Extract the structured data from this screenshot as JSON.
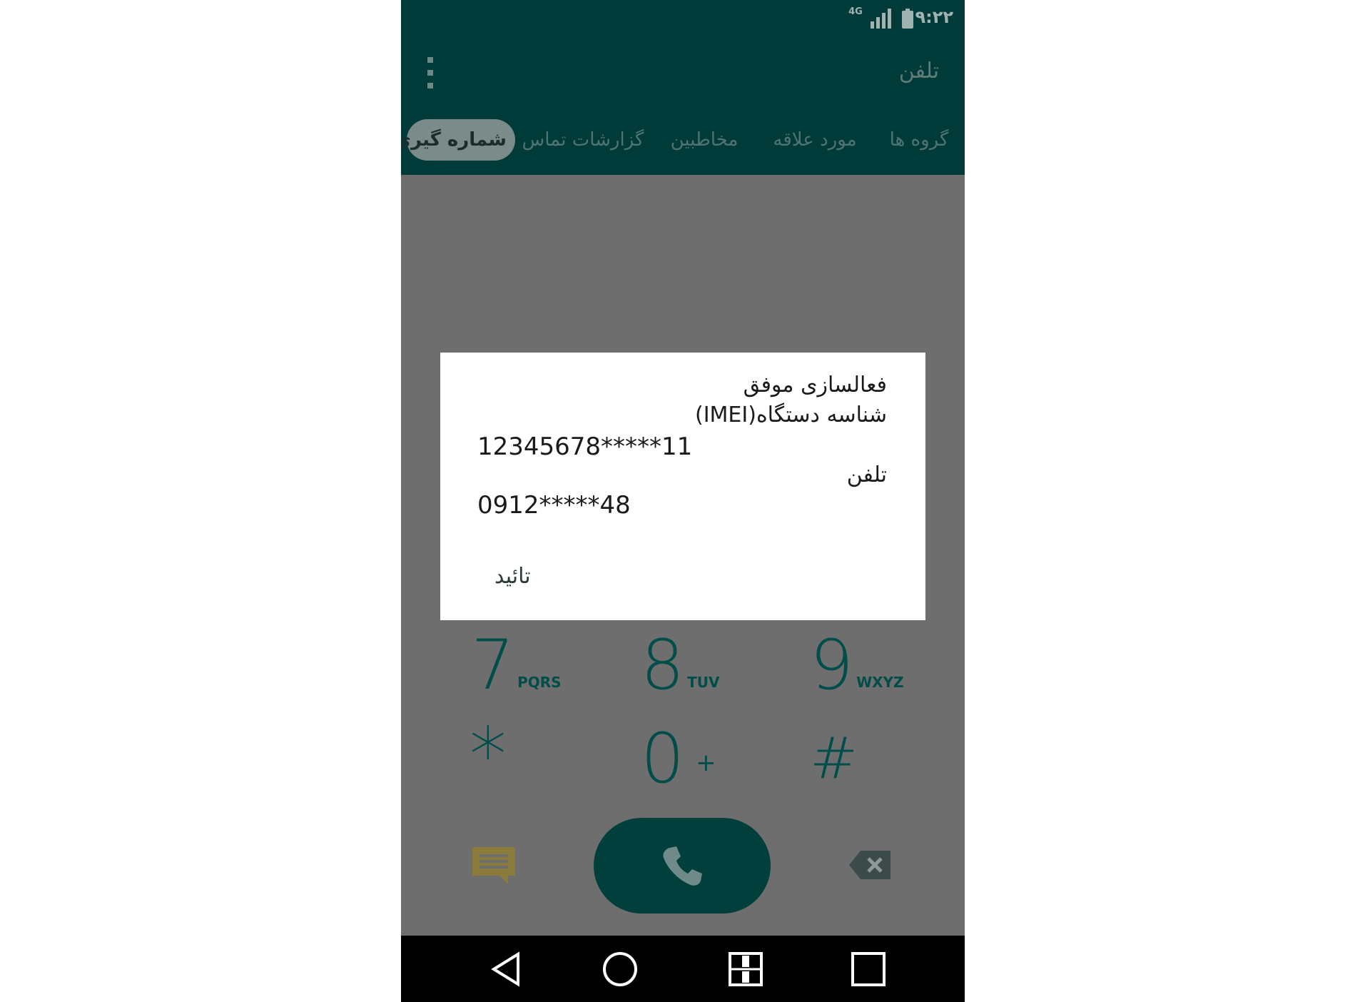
{
  "status_bar": {
    "time": "۹:۲۲",
    "network_label": "4G",
    "icons": [
      "lte-icon",
      "signal-icon",
      "battery-icon"
    ]
  },
  "app_bar": {
    "title": "تلفن",
    "menu_icon": "overflow-menu-icon"
  },
  "tabs": [
    {
      "label": "گروه ها",
      "active": false
    },
    {
      "label": "مورد علاقه",
      "active": false
    },
    {
      "label": "مخاطبین",
      "active": false
    },
    {
      "label": "گزارشات تماس",
      "active": false
    },
    {
      "label": "شماره گیری",
      "active": true
    }
  ],
  "dialpad": {
    "keys": [
      {
        "digit": "7",
        "letters": "PQRS"
      },
      {
        "digit": "8",
        "letters": "TUV"
      },
      {
        "digit": "9",
        "letters": "WXYZ"
      },
      {
        "digit": "*",
        "letters": ""
      },
      {
        "digit": "0",
        "letters": "+"
      },
      {
        "digit": "#",
        "letters": ""
      }
    ],
    "actions": [
      "message-icon",
      "call-icon",
      "backspace-icon"
    ]
  },
  "dialog": {
    "title": "فعالسازی موفق",
    "imei_label": "شناسه دستگاه(IMEI)",
    "imei_value": "12345678*****11",
    "phone_label": "تلفن",
    "phone_value": "0912*****48",
    "ok_label": "تائید"
  },
  "nav_bar": {
    "icons": [
      "back-icon",
      "home-icon",
      "dual-window-icon",
      "recents-icon"
    ]
  },
  "colors": {
    "app_bar": "#003b39",
    "accent": "#004d49",
    "scrim_background": "#6e6e6e",
    "message_icon": "#8a7a3c"
  }
}
